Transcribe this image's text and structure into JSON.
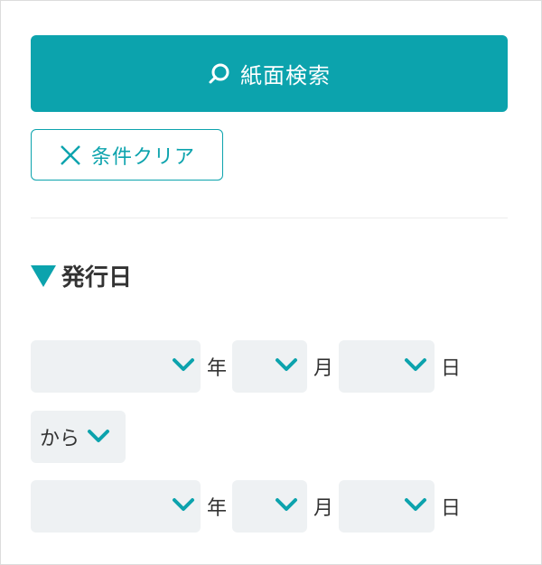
{
  "search_button": {
    "label": "紙面検索",
    "icon": "search-icon"
  },
  "clear_button": {
    "label": "条件クリア",
    "icon": "close-icon"
  },
  "section": {
    "title": "発行日",
    "icon": "triangle-down-icon"
  },
  "date_from": {
    "year_value": "",
    "year_unit": "年",
    "month_value": "",
    "month_unit": "月",
    "day_value": "",
    "day_unit": "日"
  },
  "range_select": {
    "value": "から"
  },
  "date_to": {
    "year_value": "",
    "year_unit": "年",
    "month_value": "",
    "month_unit": "月",
    "day_value": "",
    "day_unit": "日"
  },
  "colors": {
    "accent": "#0ca3ad",
    "select_bg": "#eef1f3"
  }
}
